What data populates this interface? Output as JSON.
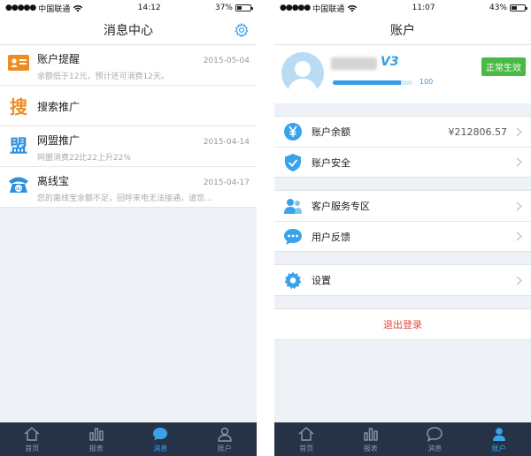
{
  "left": {
    "status": {
      "carrier": "中国联通",
      "time": "14:12",
      "battery": "37%",
      "battery_level": 0.37
    },
    "title": "消息中心",
    "messages": [
      {
        "title": "账户提醒",
        "date": "2015-05-04",
        "preview": "余额低于12元，预计还可消费12天。"
      },
      {
        "title": "搜索推广",
        "date": "",
        "preview": ""
      },
      {
        "title": "网盟推广",
        "date": "2015-04-14",
        "preview": "网盟消费22比22上升22%"
      },
      {
        "title": "离线宝",
        "date": "2015-04-17",
        "preview": "您的离线宝余额不足，回呼来电无法接通，请您..."
      }
    ],
    "icons": {
      "search_glyph": "搜",
      "union_glyph": "盟",
      "offline_glyph": "du"
    }
  },
  "right": {
    "status": {
      "carrier": "中国联通",
      "time": "11:07",
      "battery": "43%",
      "battery_level": 0.43
    },
    "title": "账户",
    "profile": {
      "vip_level": "V3",
      "progress_value": "100",
      "progress_fraction": 0.85,
      "status_badge": "正常生效"
    },
    "rows": {
      "balance_label": "账户余额",
      "balance_value": "¥212806.57",
      "security_label": "账户安全",
      "service_label": "客户服务专区",
      "feedback_label": "用户反馈",
      "settings_label": "设置"
    },
    "logout": "退出登录"
  },
  "tabs": [
    {
      "label": "首页"
    },
    {
      "label": "报表"
    },
    {
      "label": "消息"
    },
    {
      "label": "账户"
    }
  ],
  "colors": {
    "accent": "#39a3ea",
    "tabbar": "#263246",
    "danger": "#e04a3a",
    "success": "#48b944",
    "orange": "#f08c1e"
  }
}
